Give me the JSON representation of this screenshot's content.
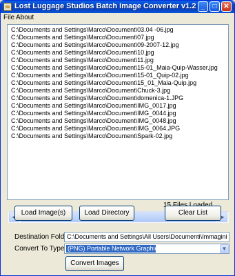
{
  "window": {
    "title": "Lost Luggage Studios Batch Image Converter v1.2",
    "minimize_glyph": "_",
    "maximize_glyph": "□",
    "close_glyph": "✕"
  },
  "menu": {
    "items": [
      {
        "label": "File"
      },
      {
        "label": "About"
      }
    ]
  },
  "file_list": {
    "items": [
      "C:\\Documents and Settings\\Marco\\Document\\03.04 -06.jpg",
      "C:\\Documents and Settings\\Marco\\Document\\07.jpg",
      "C:\\Documents and Settings\\Marco\\Document\\09-2007-12.jpg",
      "C:\\Documents and Settings\\Marco\\Document\\10.jpg",
      "C:\\Documents and Settings\\Marco\\Document\\11.jpg",
      "C:\\Documents and Settings\\Marco\\Document\\15-01_Maia-Quip-Wasser.jpg",
      "C:\\Documents and Settings\\Marco\\Document\\15-01_Quip-02.jpg",
      "C:\\Documents and Settings\\Marco\\Document\\15_01_Maia-Quip.jpg",
      "C:\\Documents and Settings\\Marco\\Document\\Chuck-3.jpg",
      "C:\\Documents and Settings\\Marco\\Document\\domenica-1.JPG",
      "C:\\Documents and Settings\\Marco\\Document\\IMG_0017.jpg",
      "C:\\Documents and Settings\\Marco\\Document\\IMG_0044.jpg",
      "C:\\Documents and Settings\\Marco\\Document\\IMG_0048.jpg",
      "C:\\Documents and Settings\\Marco\\Document\\IMG_0064.JPG",
      "C:\\Documents and Settings\\Marco\\Document\\Spark-02.jpg"
    ],
    "status": "15 Files Loaded",
    "scroll_left_glyph": "◀",
    "scroll_right_glyph": "▶"
  },
  "buttons": {
    "load_images": "Load Image(s)",
    "load_directory": "Load Directory",
    "clear_list": "Clear List",
    "convert_images": "Convert Images"
  },
  "form": {
    "destination_label": "Destination Folder:",
    "destination_value": "C:\\Documents and Settings\\All Users\\Documenti\\Immagini",
    "convert_label": "Convert To Type:",
    "convert_value": "(PNG) Portable Network Graphics",
    "dropdown_glyph": "▼"
  }
}
